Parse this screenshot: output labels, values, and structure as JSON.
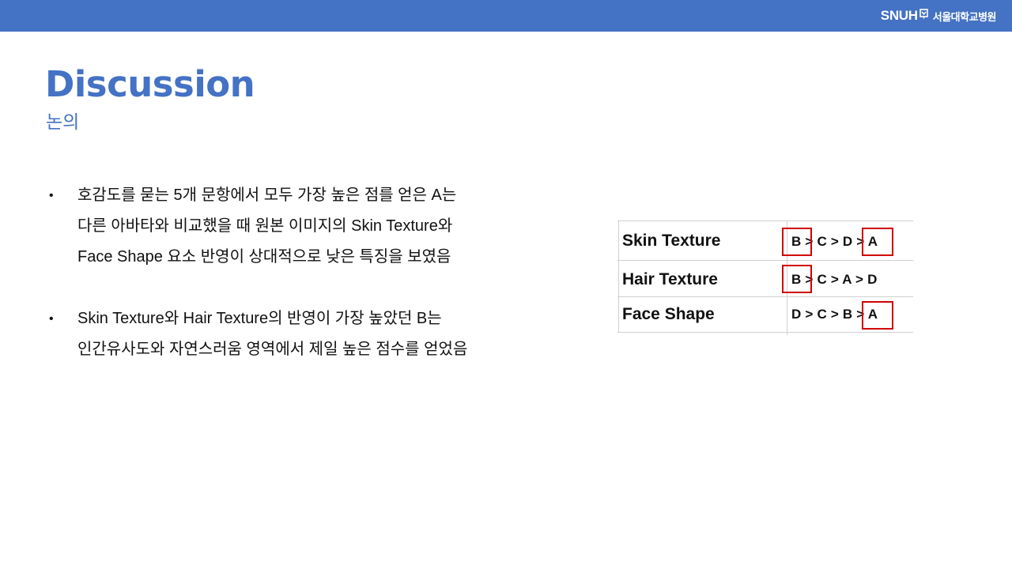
{
  "header": {
    "logo_text": "SNUH",
    "logo_korean": "서울대학교병원",
    "bar_color": "#4472c4"
  },
  "page": {
    "title": "Discussion",
    "subtitle": "논의",
    "accent_color": "#4472c4"
  },
  "bullets": [
    {
      "marker": "•",
      "lines": [
        "호감도를 묻는 5개 문항에서 모두 가장 높은 점를 얻은 A는",
        "다른 아바타와 비교했을 때 원본 이미지의 Skin Texture와",
        "Face Shape 요소 반영이 상대적으로 낮은 특징을 보였음"
      ]
    },
    {
      "marker": "•",
      "lines": [
        "Skin Texture와 Hair Texture의 반영이 가장 높았던 B는",
        "인간유사도와 자연스러움 영역에서 제일 높은 점수를 얻었음"
      ]
    }
  ],
  "ranking_table": {
    "rows": [
      {
        "label": "Skin Texture",
        "order": "B > C > D > A",
        "highlighted": [
          "B",
          "A"
        ]
      },
      {
        "label": "Hair Texture",
        "order": "B > C > A > D",
        "highlighted": [
          "B"
        ]
      },
      {
        "label": "Face Shape",
        "order": "D > C > B > A",
        "highlighted": [
          "A"
        ]
      }
    ],
    "highlight_color": "#d00000"
  }
}
